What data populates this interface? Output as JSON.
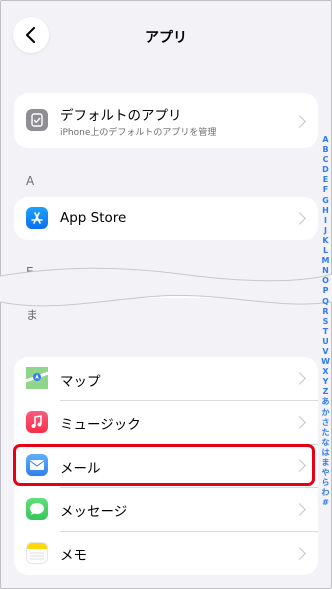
{
  "header": {
    "title": "アプリ"
  },
  "default_apps": {
    "title": "デフォルトのアプリ",
    "subtitle": "iPhone上のデフォルトのアプリを管理"
  },
  "sections": {
    "a_letter": "A",
    "e_letter": "E",
    "ma_letter": "ま"
  },
  "a_apps": [
    {
      "label": "App Store",
      "icon": "app-store-icon",
      "color": "#1a8cff"
    }
  ],
  "ma_apps": [
    {
      "label": "マップ",
      "icon": "maps-icon",
      "color": "#59c25a"
    },
    {
      "label": "ミュージック",
      "icon": "music-icon",
      "color": "#fa2d48"
    },
    {
      "label": "メール",
      "icon": "mail-icon",
      "color": "#2f80ed"
    },
    {
      "label": "メッセージ",
      "icon": "messages-icon",
      "color": "#34c759"
    },
    {
      "label": "メモ",
      "icon": "notes-icon",
      "color": "#ffd60a"
    }
  ],
  "index": [
    "A",
    "B",
    "C",
    "D",
    "E",
    "F",
    "G",
    "H",
    "I",
    "J",
    "K",
    "L",
    "M",
    "N",
    "O",
    "P",
    "Q",
    "R",
    "S",
    "T",
    "U",
    "V",
    "W",
    "X",
    "Y",
    "Z",
    "あ",
    "か",
    "さ",
    "た",
    "な",
    "は",
    "ま",
    "や",
    "ら",
    "わ",
    "#"
  ],
  "colors": {
    "accent": "#2f7cf6",
    "highlight": "#e60012",
    "background": "#f2f2f7"
  }
}
